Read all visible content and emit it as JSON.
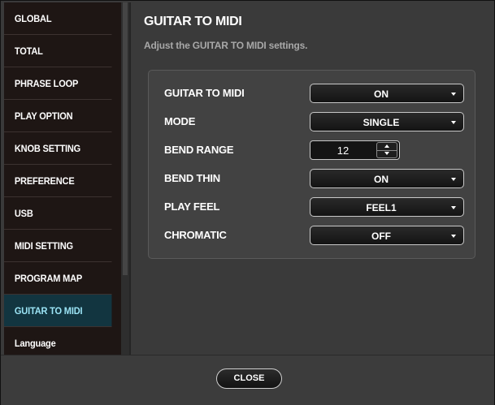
{
  "sidebar": {
    "items": [
      {
        "label": "GLOBAL"
      },
      {
        "label": "TOTAL"
      },
      {
        "label": "PHRASE LOOP"
      },
      {
        "label": "PLAY OPTION"
      },
      {
        "label": "KNOB SETTING"
      },
      {
        "label": "PREFERENCE"
      },
      {
        "label": "USB"
      },
      {
        "label": "MIDI SETTING"
      },
      {
        "label": "PROGRAM MAP"
      },
      {
        "label": "GUITAR TO MIDI"
      },
      {
        "label": "Language"
      }
    ],
    "active_index": 9
  },
  "main": {
    "title": "GUITAR TO MIDI",
    "subtitle": "Adjust the GUITAR TO MIDI settings.",
    "settings": [
      {
        "label": "GUITAR TO MIDI",
        "value": "ON",
        "control": "dropdown"
      },
      {
        "label": "MODE",
        "value": "SINGLE",
        "control": "dropdown"
      },
      {
        "label": "BEND RANGE",
        "value": "12",
        "control": "stepper"
      },
      {
        "label": "BEND THIN",
        "value": "ON",
        "control": "dropdown"
      },
      {
        "label": "PLAY FEEL",
        "value": "FEEL1",
        "control": "dropdown"
      },
      {
        "label": "CHROMATIC",
        "value": "OFF",
        "control": "dropdown"
      }
    ]
  },
  "footer": {
    "close_label": "CLOSE"
  },
  "colors": {
    "active_item_bg": "#123540",
    "active_item_text": "#9be4f5",
    "sidebar_bg": "#1e1614",
    "window_bg": "#3a3a3a"
  }
}
